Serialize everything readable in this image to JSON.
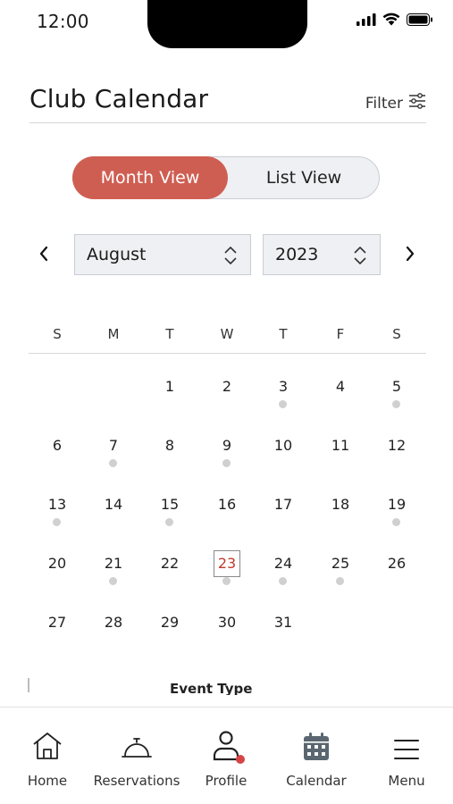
{
  "status_bar": {
    "time": "12:00"
  },
  "header": {
    "title": "Club Calendar",
    "filter_label": "Filter"
  },
  "view_toggle": {
    "month_label": "Month View",
    "list_label": "List View",
    "selected": "Month View"
  },
  "selectors": {
    "month": "August",
    "year": "2023"
  },
  "colors": {
    "accent": "#cf5e52",
    "today": "#c0392b",
    "dot": "#d0d0d0",
    "badge": "#d64545"
  },
  "calendar": {
    "weekdays": [
      "S",
      "M",
      "T",
      "W",
      "T",
      "F",
      "S"
    ],
    "today": 23,
    "event_days": [
      3,
      5,
      7,
      9,
      13,
      15,
      19,
      21,
      23,
      24,
      25
    ],
    "weeks": [
      [
        "",
        "",
        "1",
        "2",
        "3",
        "4",
        "5"
      ],
      [
        "6",
        "7",
        "8",
        "9",
        "10",
        "11",
        "12"
      ],
      [
        "13",
        "14",
        "15",
        "16",
        "17",
        "18",
        "19"
      ],
      [
        "20",
        "21",
        "22",
        "23",
        "24",
        "25",
        "26"
      ],
      [
        "27",
        "28",
        "29",
        "30",
        "31",
        "",
        ""
      ]
    ]
  },
  "event_type": {
    "label": "Event Type"
  },
  "tab_bar": {
    "items": [
      {
        "label": "Home",
        "icon": "home-icon"
      },
      {
        "label": "Reservations",
        "icon": "service-bell-icon"
      },
      {
        "label": "Profile",
        "icon": "profile-icon"
      },
      {
        "label": "Calendar",
        "icon": "calendar-icon"
      },
      {
        "label": "Menu",
        "icon": "menu-icon"
      }
    ]
  }
}
